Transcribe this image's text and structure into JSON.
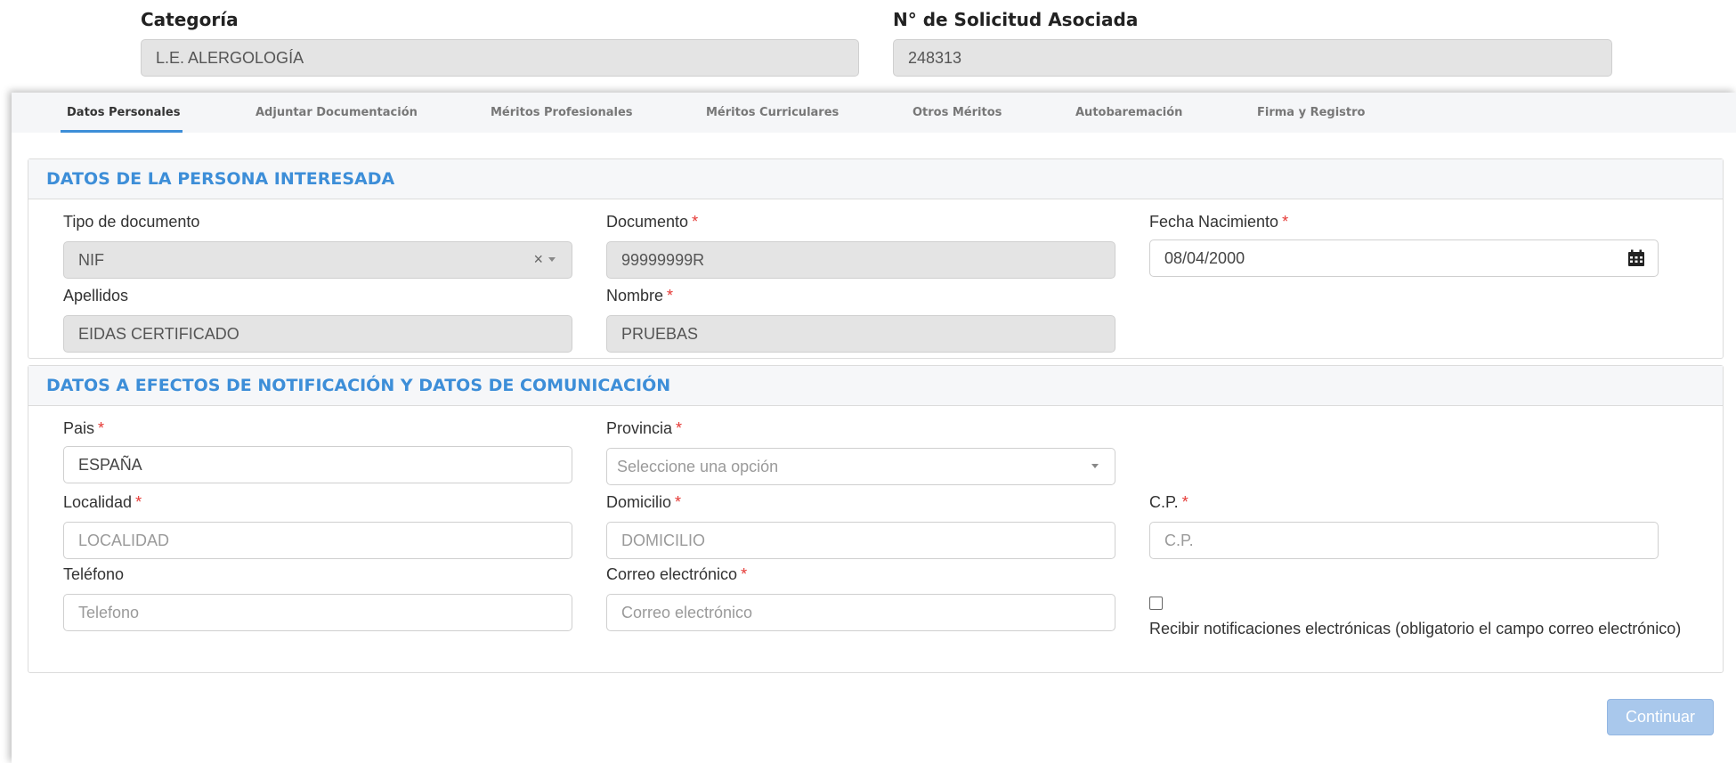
{
  "top": {
    "categoria_label": "Categoría",
    "categoria_value": "L.E. ALERGOLOGÍA",
    "solicitud_label": "N° de Solicitud Asociada",
    "solicitud_value": "248313"
  },
  "tabs": [
    {
      "label": "Datos Personales",
      "active": true
    },
    {
      "label": "Adjuntar Documentación",
      "active": false
    },
    {
      "label": "Méritos Profesionales",
      "active": false
    },
    {
      "label": "Méritos Curriculares",
      "active": false
    },
    {
      "label": "Otros Méritos",
      "active": false
    },
    {
      "label": "Autobaremación",
      "active": false
    },
    {
      "label": "Firma y Registro",
      "active": false
    }
  ],
  "section_personal": {
    "title": "DATOS DE LA PERSONA INTERESADA",
    "tipo_documento": {
      "label": "Tipo de documento",
      "value": "NIF"
    },
    "documento": {
      "label": "Documento",
      "value": "99999999R"
    },
    "fecha_nacimiento": {
      "label": "Fecha Nacimiento",
      "value": "08/04/2000"
    },
    "apellidos": {
      "label": "Apellidos",
      "value": "EIDAS CERTIFICADO"
    },
    "nombre": {
      "label": "Nombre",
      "value": "PRUEBAS"
    }
  },
  "section_notificacion": {
    "title": "DATOS A EFECTOS DE NOTIFICACIÓN Y DATOS DE COMUNICACIÓN",
    "pais": {
      "label": "Pais",
      "value": "ESPAÑA"
    },
    "provincia": {
      "label": "Provincia",
      "placeholder": "Seleccione una opción"
    },
    "localidad": {
      "label": "Localidad",
      "placeholder": "LOCALIDAD"
    },
    "domicilio": {
      "label": "Domicilio",
      "placeholder": "DOMICILIO"
    },
    "cp": {
      "label": "C.P.",
      "placeholder": "C.P."
    },
    "telefono": {
      "label": "Teléfono",
      "placeholder": "Telefono"
    },
    "correo": {
      "label": "Correo electrónico",
      "placeholder": "Correo electrónico"
    },
    "notificaciones": {
      "label": "Recibir notificaciones electrónicas (obligatorio el campo correo electrónico)",
      "checked": false
    }
  },
  "required_mark": "*",
  "continue_label": "Continuar",
  "colors": {
    "accent": "#3d8ed8",
    "required": "#e53935",
    "button": "#a9c8ec"
  }
}
